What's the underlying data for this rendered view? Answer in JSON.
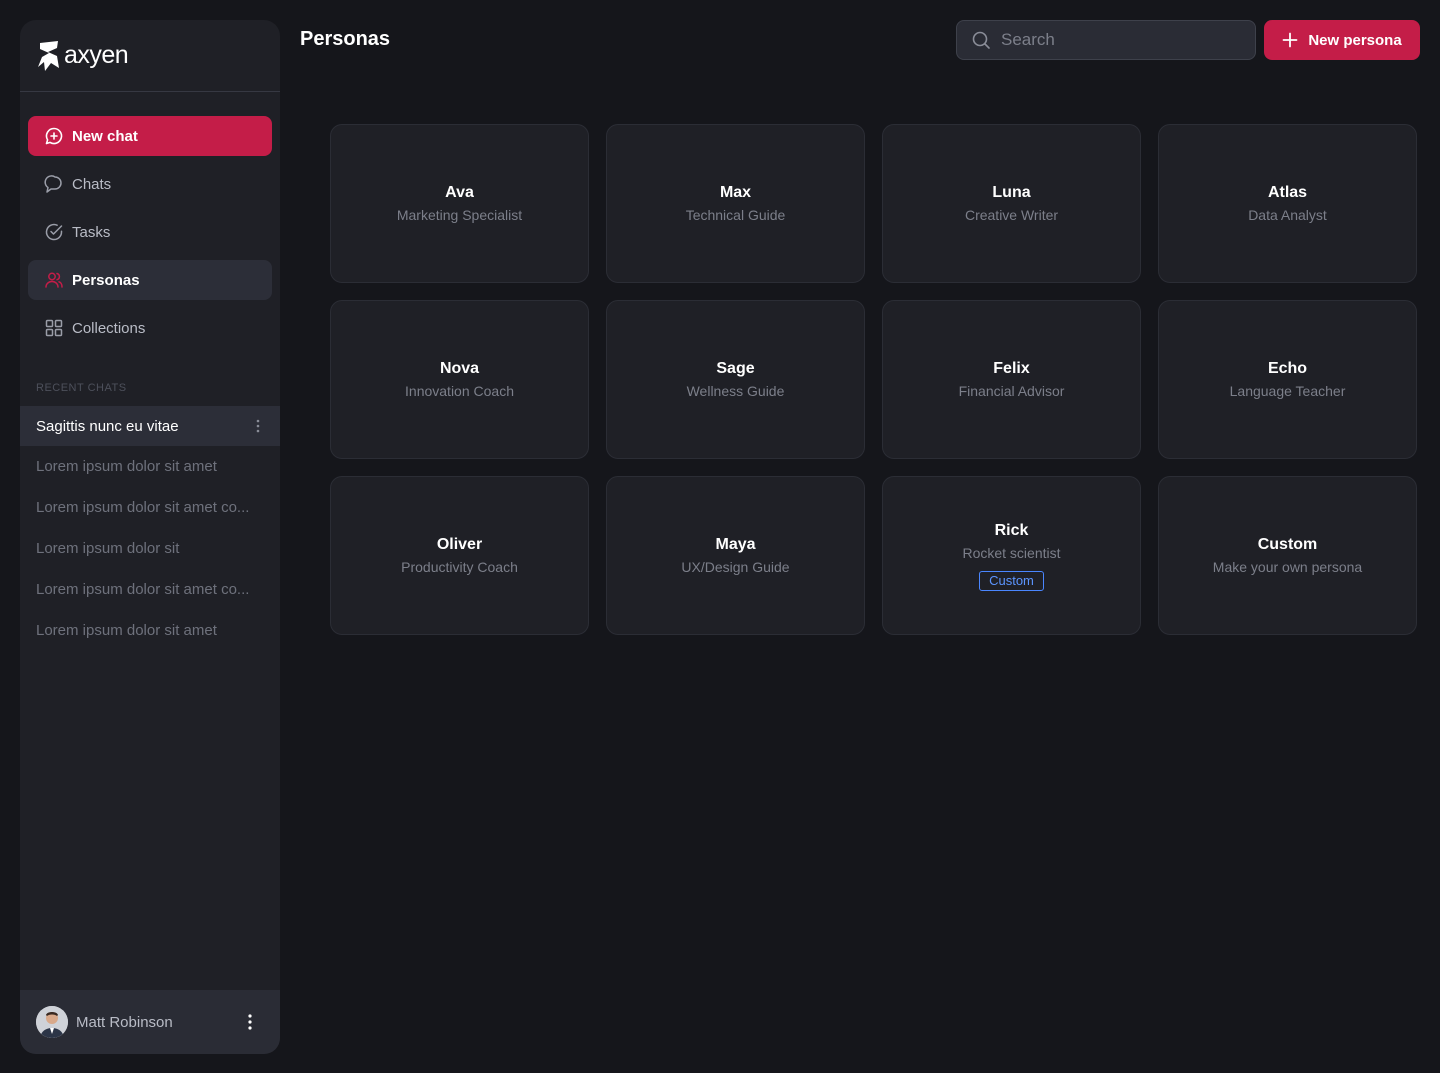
{
  "app": {
    "logo_text": "axyen"
  },
  "colors": {
    "accent": "#c41d48",
    "badge": "#4a86ff",
    "background": "#15161b",
    "panel": "#1f2026"
  },
  "sidebar": {
    "nav": [
      {
        "label": "New chat",
        "icon": "chat-plus-icon"
      },
      {
        "label": "Chats",
        "icon": "chat-bubble-icon"
      },
      {
        "label": "Tasks",
        "icon": "check-circle-icon"
      },
      {
        "label": "Personas",
        "icon": "users-icon"
      },
      {
        "label": "Collections",
        "icon": "grid-icon"
      }
    ],
    "recent_heading": "RECENT CHATS",
    "recent_chats": [
      "Sagittis nunc eu vitae",
      "Lorem ipsum dolor sit amet",
      "Lorem ipsum dolor sit amet co...",
      "Lorem ipsum dolor sit",
      "Lorem ipsum dolor sit amet co...",
      "Lorem ipsum dolor sit amet"
    ],
    "user": {
      "name": "Matt Robinson"
    }
  },
  "header": {
    "title": "Personas",
    "search_placeholder": "Search",
    "new_button": "New persona"
  },
  "personas": [
    {
      "name": "Ava",
      "role": "Marketing Specialist"
    },
    {
      "name": "Max",
      "role": "Technical Guide"
    },
    {
      "name": "Luna",
      "role": "Creative Writer"
    },
    {
      "name": "Atlas",
      "role": "Data Analyst"
    },
    {
      "name": "Nova",
      "role": "Innovation Coach"
    },
    {
      "name": "Sage",
      "role": "Wellness Guide"
    },
    {
      "name": "Felix",
      "role": "Financial Advisor"
    },
    {
      "name": "Echo",
      "role": "Language Teacher"
    },
    {
      "name": "Oliver",
      "role": "Productivity Coach"
    },
    {
      "name": "Maya",
      "role": "UX/Design Guide"
    },
    {
      "name": "Rick",
      "role": "Rocket scientist",
      "badge": "Custom"
    },
    {
      "name": "Custom",
      "role": "Make your own persona"
    }
  ]
}
